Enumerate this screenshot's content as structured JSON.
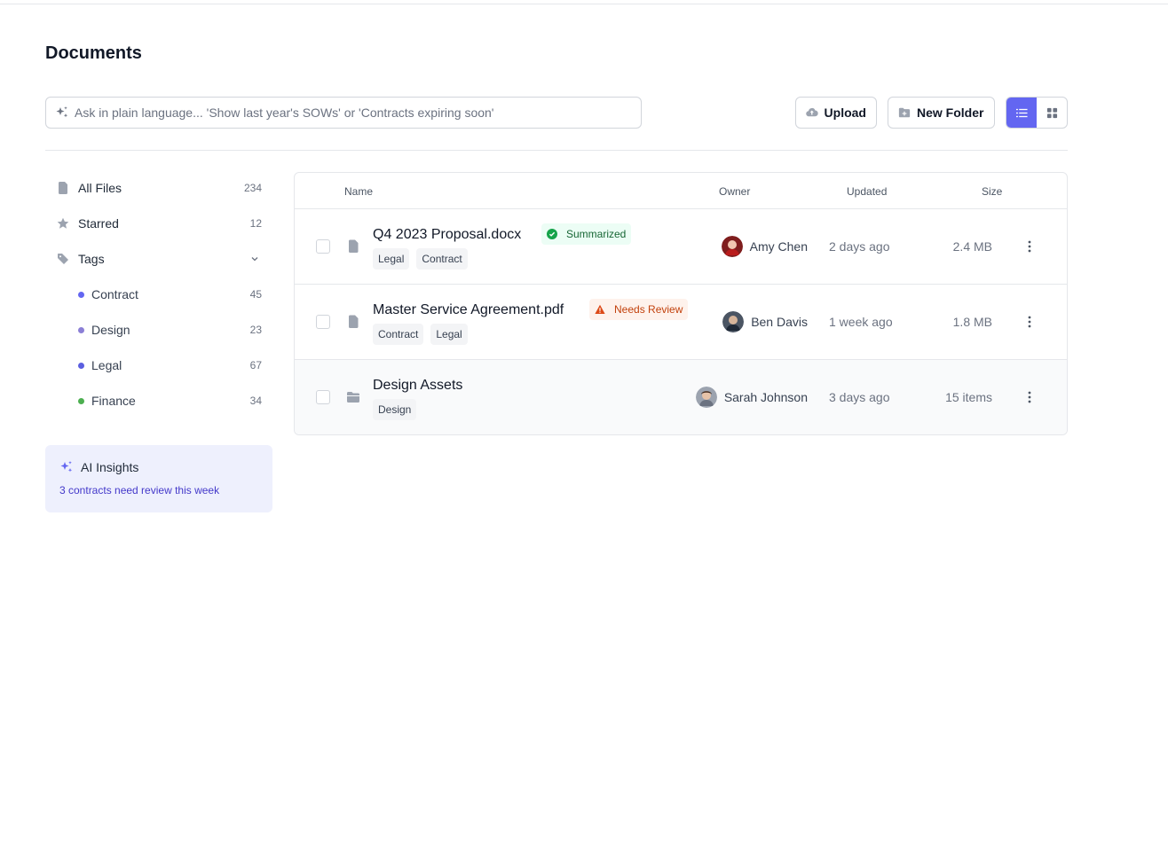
{
  "page": {
    "title": "Documents"
  },
  "search": {
    "placeholder": "Ask in plain language... 'Show last year's SOWs' or 'Contracts expiring soon'"
  },
  "toolbar": {
    "upload_label": "Upload",
    "new_folder_label": "New Folder",
    "view_mode": "list"
  },
  "sidebar": {
    "items": [
      {
        "label": "All Files",
        "count": "234",
        "icon": "file-icon"
      },
      {
        "label": "Starred",
        "count": "12",
        "icon": "star-icon"
      },
      {
        "label": "Tags",
        "icon": "tag-icon",
        "expanded": true
      }
    ],
    "tags": [
      {
        "label": "Contract",
        "count": "45",
        "color": "#6366f1"
      },
      {
        "label": "Design",
        "count": "23",
        "color": "#8b7fd6"
      },
      {
        "label": "Legal",
        "count": "67",
        "color": "#5b5fe0"
      },
      {
        "label": "Finance",
        "count": "34",
        "color": "#4caf50"
      }
    ]
  },
  "insights": {
    "title": "AI Insights",
    "message": "3 contracts need review this week"
  },
  "table": {
    "columns": {
      "name": "Name",
      "owner": "Owner",
      "updated": "Updated",
      "size": "Size"
    },
    "rows": [
      {
        "name": "Q4 2023 Proposal.docx",
        "type": "file",
        "status": "Summarized",
        "status_kind": "success",
        "tags": [
          "Legal",
          "Contract"
        ],
        "owner": "Amy Chen",
        "updated": "2 days ago",
        "size": "2.4 MB"
      },
      {
        "name": "Master Service Agreement.pdf",
        "type": "file",
        "status": "Needs Review",
        "status_kind": "warning",
        "tags": [
          "Contract",
          "Legal"
        ],
        "owner": "Ben Davis",
        "updated": "1 week ago",
        "size": "1.8 MB"
      },
      {
        "name": "Design Assets",
        "type": "folder",
        "tags": [
          "Design"
        ],
        "owner": "Sarah Johnson",
        "updated": "3 days ago",
        "size": "15 items"
      }
    ]
  },
  "colors": {
    "accent": "#6366f1",
    "success_bg": "#ecfdf5",
    "warning_bg": "#fef2ec"
  }
}
